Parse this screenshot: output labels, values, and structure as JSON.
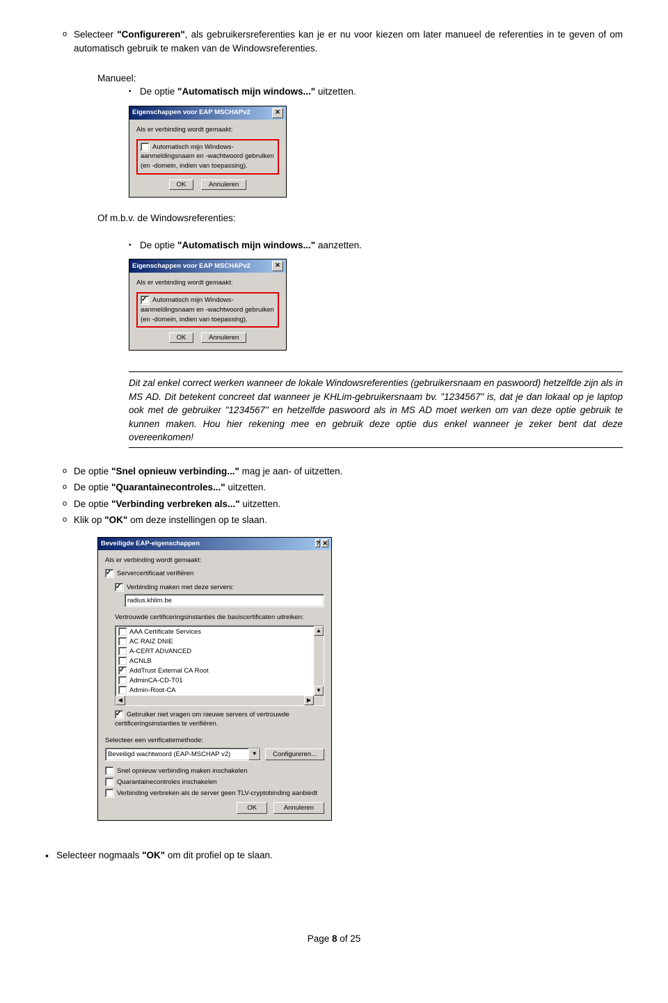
{
  "para1_pre": "Selecteer ",
  "para1_b": "\"Configureren\"",
  "para1_post": ", als gebruikersreferenties kan je er nu voor kiezen om later manueel de referenties in te geven of om automatisch gebruik te maken van de Windowsreferenties.",
  "manueel": "Manueel:",
  "man_item_pre": "De optie ",
  "man_item_b": "\"Automatisch mijn windows...\"",
  "man_item_post": " uitzetten.",
  "ofmbv": "Of m.b.v. de Windowsreferenties:",
  "aan_item_pre": "De optie ",
  "aan_item_b": "\"Automatisch mijn windows...\"",
  "aan_item_post": " aanzetten.",
  "dlg_small": {
    "title": "Eigenschappen voor EAP MSCHAPv2",
    "hdr": "Als er verbinding wordt gemaakt:",
    "chk_txt": "Automatisch mijn Windows-aanmeldingsnaam en -wachtwoord gebruiken (en -domein, indien van toepassing).",
    "ok": "OK",
    "cancel": "Annuleren"
  },
  "note_text": "Dit zal enkel correct werken wanneer de lokale Windowsreferenties (gebruikersnaam en paswoord) hetzelfde zijn als in MS AD. Dit betekent concreet dat wanneer je KHLim-gebruikersnaam bv. \"1234567\" is, dat je dan lokaal op je laptop ook met de gebruiker \"1234567\" en hetzelfde paswoord als in MS AD moet werken om van deze optie gebruik te kunnen maken. Hou hier rekening mee en gebruik deze optie dus enkel wanneer je zeker bent dat deze overeenkomen!",
  "bullets2": {
    "b1_pre": "De optie ",
    "b1_b": "\"Snel opnieuw verbinding...\"",
    "b1_post": " mag je aan- of uitzetten.",
    "b2_pre": "De optie ",
    "b2_b": "\"Quarantainecontroles...\"",
    "b2_post": " uitzetten.",
    "b3_pre": "De optie ",
    "b3_b": "\"Verbinding verbreken als...\"",
    "b3_post": " uitzetten.",
    "b4_pre": "Klik op ",
    "b4_b": "\"OK\"",
    "b4_post": " om deze instellingen op te slaan."
  },
  "dlg_big": {
    "title": "Beveiligde EAP-eigenschappen",
    "hdr": "Als er verbinding wordt gemaakt:",
    "chk_servercert": "Servercertificaat verifiëren",
    "chk_verbmaken": "Verbinding maken met deze servers:",
    "server_value": "radius.khlim.be",
    "trust_label": "Vertrouwde certificeringsinstanties die basiscertificaten uitreiken:",
    "list": [
      {
        "checked": false,
        "label": "AAA Certificate Services"
      },
      {
        "checked": false,
        "label": "AC RAIZ DNIE"
      },
      {
        "checked": false,
        "label": "A-CERT ADVANCED"
      },
      {
        "checked": false,
        "label": "ACNLB"
      },
      {
        "checked": true,
        "label": "AddTrust External CA Root"
      },
      {
        "checked": false,
        "label": "AdminCA-CD-T01"
      },
      {
        "checked": false,
        "label": "Admin-Root-CA"
      }
    ],
    "chk_nietvragen": "Gebruiker niet vragen om nieuwe servers of vertrouwde certificeringsinstanties te verifiëren.",
    "verif_label": "Selecteer een verificatiemethode:",
    "verif_value": "Beveiligd wachtwoord (EAP-MSCHAP v2)",
    "configure": "Configureren...",
    "chk_snel": "Snel opnieuw verbinding maken inschakelen",
    "chk_quar": "Quarantainecontroles inschakelen",
    "chk_tlv": "Verbinding verbreken als de server geen TLV-cryptobinding aanbiedt",
    "ok": "OK",
    "cancel": "Annuleren"
  },
  "last_pre": "Selecteer nogmaals ",
  "last_b": "\"OK\"",
  "last_post": " om dit profiel op te slaan.",
  "footer_pre": "Page ",
  "footer_b": "8",
  "footer_mid": " of ",
  "footer_end": "25"
}
